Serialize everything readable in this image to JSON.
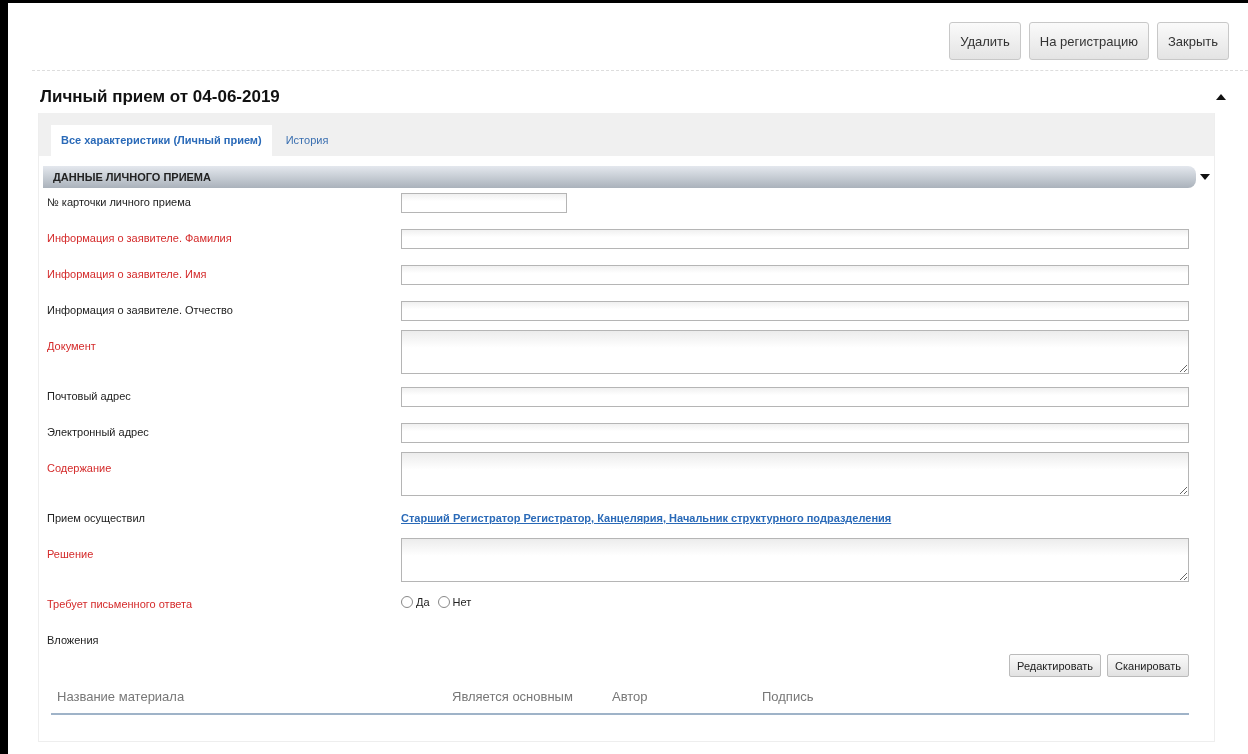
{
  "toolbar": {
    "buttons": [
      "Удалить",
      "На регистрацию",
      "Закрыть"
    ]
  },
  "title": "Личный прием от 04-06-2019",
  "expanded": true,
  "tabs": [
    {
      "label": "Все характеристики (Личный прием)",
      "selected": true
    },
    {
      "label": "История",
      "selected": false
    }
  ],
  "section": {
    "title": "ДАННЫЕ ЛИЧНОГО ПРИЕМА",
    "expanded": true
  },
  "fields": [
    {
      "label": "№ карточки личного приема",
      "required": false,
      "kind": "short"
    },
    {
      "label": "Информация о заявителе. Фамилия",
      "required": true,
      "kind": "input"
    },
    {
      "label": "Информация о заявителе. Имя",
      "required": true,
      "kind": "input"
    },
    {
      "label": "Информация о заявителе. Отчество",
      "required": false,
      "kind": "input"
    },
    {
      "label": "Документ",
      "required": true,
      "kind": "textarea"
    },
    {
      "label": "Почтовый адрес",
      "required": false,
      "kind": "input"
    },
    {
      "label": "Электронный адрес",
      "required": false,
      "kind": "input"
    },
    {
      "label": "Содержание",
      "required": true,
      "kind": "textarea"
    },
    {
      "label": "Прием осуществил",
      "required": false,
      "kind": "link",
      "value": "Старший Регистратор Регистратор, Канцелярия, Начальник структурного подразделения"
    },
    {
      "label": "Решение",
      "required": true,
      "kind": "textarea"
    },
    {
      "label": "Требует письменного ответа",
      "required": true,
      "kind": "radio",
      "options": [
        {
          "label": "Да",
          "selected": false
        },
        {
          "label": "Нет",
          "selected": false
        }
      ]
    },
    {
      "label": "Вложения",
      "required": false,
      "kind": "none"
    }
  ],
  "attachments": {
    "buttons": [
      "Редактировать",
      "Сканировать"
    ],
    "columns": [
      "Название материала",
      "Является основным",
      "Автор",
      "Подпись"
    ]
  }
}
